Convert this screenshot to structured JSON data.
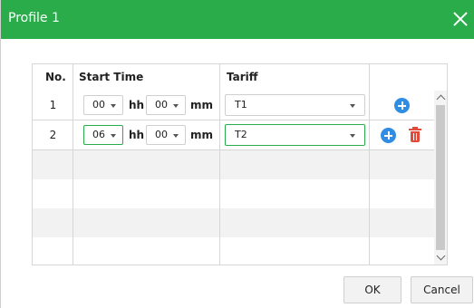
{
  "dialog": {
    "title": "Profile 1"
  },
  "grid": {
    "headers": {
      "no": "No.",
      "start_time": "Start Time",
      "tariff": "Tariff"
    },
    "rows": [
      {
        "no": "1",
        "hh": "00",
        "mm": "00",
        "hh_unit": "hh",
        "mm_unit": "mm",
        "tariff": "T1"
      },
      {
        "no": "2",
        "hh": "06",
        "mm": "00",
        "hh_unit": "hh",
        "mm_unit": "mm",
        "tariff": "T2"
      }
    ],
    "empty_rows": 4
  },
  "buttons": {
    "ok": "OK",
    "cancel": "Cancel"
  },
  "colors": {
    "titlebar": "#2aac4b",
    "add_icon": "#2f8de4",
    "delete_icon": "#e14b3b"
  },
  "icons": {
    "close": "close-icon",
    "add": "plus-circle-icon",
    "delete": "trash-icon"
  }
}
